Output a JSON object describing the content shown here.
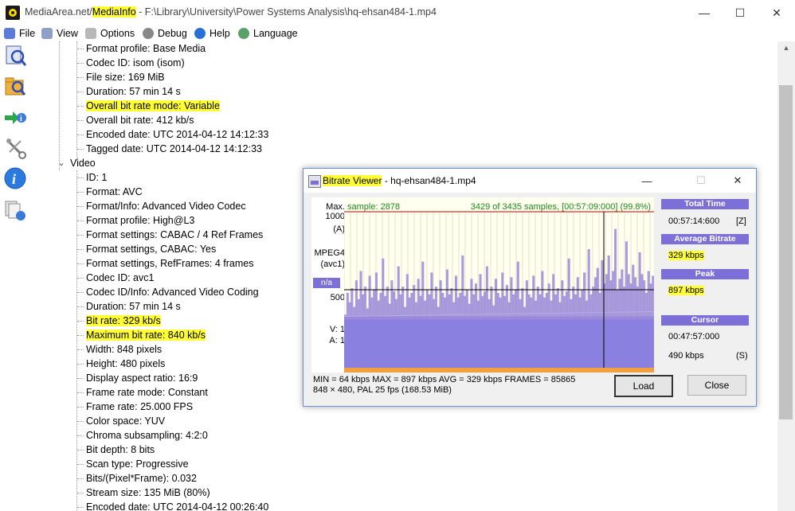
{
  "window": {
    "title_part1": "MediaArea.net/",
    "title_part2": "MediaInfo",
    "title_part3": " - F:\\Library\\University\\Power Systems Analysis\\hq-ehsan484-1.mp4",
    "minimize": "—",
    "maximize": "☐",
    "close": "✕"
  },
  "menu": [
    {
      "label": "File",
      "icon": "file-icon"
    },
    {
      "label": "View",
      "icon": "view-icon"
    },
    {
      "label": "Options",
      "icon": "options-icon"
    },
    {
      "label": "Debug",
      "icon": "debug-icon"
    },
    {
      "label": "Help",
      "icon": "help-icon"
    },
    {
      "label": "Language",
      "icon": "language-icon"
    }
  ],
  "toolbar": [
    "open-file-icon",
    "open-folder-icon",
    "export-icon",
    "preferences-icon",
    "about-icon",
    "knowledge-base-icon"
  ],
  "tree": {
    "general_rows": [
      {
        "text": "Format profile: Base Media",
        "hl": false
      },
      {
        "text": "Codec ID: isom (isom)",
        "hl": false
      },
      {
        "text": "File size: 169 MiB",
        "hl": false
      },
      {
        "text": "Duration: 57 min 14 s",
        "hl": false
      },
      {
        "text": "Overall bit rate mode: Variable",
        "hl": true
      },
      {
        "text": "Overall bit rate: 412 kb/s",
        "hl": false
      },
      {
        "text": "Encoded date: UTC 2014-04-12 14:12:33",
        "hl": false
      },
      {
        "text": "Tagged date: UTC 2014-04-12 14:12:33",
        "hl": false
      }
    ],
    "video_label": "Video",
    "video_rows": [
      {
        "text": "ID: 1",
        "hl": false
      },
      {
        "text": "Format: AVC",
        "hl": false
      },
      {
        "text": "Format/Info: Advanced Video Codec",
        "hl": false
      },
      {
        "text": "Format profile: High@L3",
        "hl": false
      },
      {
        "text": "Format settings: CABAC / 4 Ref Frames",
        "hl": false
      },
      {
        "text": "Format settings, CABAC: Yes",
        "hl": false
      },
      {
        "text": "Format settings, RefFrames: 4 frames",
        "hl": false
      },
      {
        "text": "Codec ID: avc1",
        "hl": false
      },
      {
        "text": "Codec ID/Info: Advanced Video Coding",
        "hl": false
      },
      {
        "text": "Duration: 57 min 14 s",
        "hl": false
      },
      {
        "text": "Bit rate: 329 kb/s",
        "hl": true
      },
      {
        "text": "Maximum bit rate: 840 kb/s",
        "hl": true
      },
      {
        "text": "Width: 848 pixels",
        "hl": false
      },
      {
        "text": "Height: 480 pixels",
        "hl": false
      },
      {
        "text": "Display aspect ratio: 16:9",
        "hl": false
      },
      {
        "text": "Frame rate mode: Constant",
        "hl": false
      },
      {
        "text": "Frame rate: 25.000 FPS",
        "hl": false
      },
      {
        "text": "Color space: YUV",
        "hl": false
      },
      {
        "text": "Chroma subsampling: 4:2:0",
        "hl": false
      },
      {
        "text": "Bit depth: 8 bits",
        "hl": false
      },
      {
        "text": "Scan type: Progressive",
        "hl": false
      },
      {
        "text": "Bits/(Pixel*Frame): 0.032",
        "hl": false
      },
      {
        "text": "Stream size: 135 MiB (80%)",
        "hl": false
      },
      {
        "text": "Encoded date: UTC 2014-04-12 00:26:40",
        "hl": false
      }
    ]
  },
  "bitrate_viewer": {
    "title_name": "Bitrate Viewer",
    "title_rest": " - hq-ehsan484-1.mp4",
    "left_labels": {
      "max": "Max.",
      "max_value": "1000",
      "max_unit": "(A)",
      "stream": "MPEG4",
      "codec": "(avc1)",
      "na": "n/a",
      "y500": "500",
      "v_label": "V:  1",
      "a_label": "A:  1"
    },
    "sample_text": "sample: 2878",
    "samples_info": "3429 of 3435 samples, [00:57:09:000] (99.8%)",
    "panel": {
      "total_time_label": "Total Time",
      "total_time": "00:57:14:600",
      "total_time_key": "[Z]",
      "avg_label": "Average Bitrate",
      "avg_value": "329 kbps",
      "peak_label": "Peak",
      "peak_value": "897 kbps",
      "cursor_label": "Cursor",
      "cursor_time": "00:47:57:000",
      "cursor_bitrate": "490 kbps",
      "cursor_key": "(S)"
    },
    "stats_line1": "MIN = 64 kbps  MAX = 897 kbps  AVG = 329 kbps  FRAMES = 85865",
    "stats_line2": "848 × 480, PAL 25 fps    (168.53 MiB)",
    "load_label": "Load",
    "close_label": "Close",
    "colors": {
      "header": "#7c6fd7",
      "bars": "#9a8ad8",
      "background": "#fffff0",
      "max_line": "#cc0000",
      "progress": "#f0a040"
    }
  },
  "chart_data": {
    "type": "area",
    "xlabel": "",
    "ylabel": "",
    "ylim": [
      0,
      1000
    ],
    "y_ticks": [
      "500",
      "1000"
    ],
    "avg": 329,
    "max": 897,
    "min": 64,
    "cursor_fraction": 0.838,
    "series": [
      {
        "values": [
          340,
          480,
          420,
          510,
          390,
          560,
          440,
          620,
          470,
          520,
          380,
          590,
          450,
          500,
          610,
          430,
          480,
          700,
          460,
          520,
          410,
          560,
          490,
          440,
          650,
          470,
          520,
          390,
          600,
          450,
          480,
          530,
          420,
          570,
          460,
          680,
          430,
          500,
          470,
          610,
          440,
          520,
          390,
          560,
          480,
          450,
          630,
          470,
          510,
          420,
          590,
          450,
          480,
          720,
          460,
          500,
          410,
          570,
          470,
          540,
          430,
          600,
          460,
          490,
          650,
          440,
          520,
          400,
          570,
          480,
          450,
          610,
          460,
          530,
          420,
          580,
          470,
          500,
          680,
          440,
          510,
          390,
          560,
          470,
          450,
          590,
          430,
          520,
          470,
          620,
          450,
          480,
          540,
          430,
          600,
          470,
          510,
          420,
          560,
          460,
          490,
          700,
          440,
          520,
          470,
          580,
          450,
          500,
          610,
          430,
          760,
          470,
          520,
          580,
          640,
          480,
          690,
          540,
          600,
          720,
          560,
          620,
          890,
          500,
          570,
          630,
          520,
          810,
          600,
          540,
          660,
          580,
          520,
          740,
          600,
          560,
          480,
          620,
          540,
          590
        ]
      }
    ]
  }
}
